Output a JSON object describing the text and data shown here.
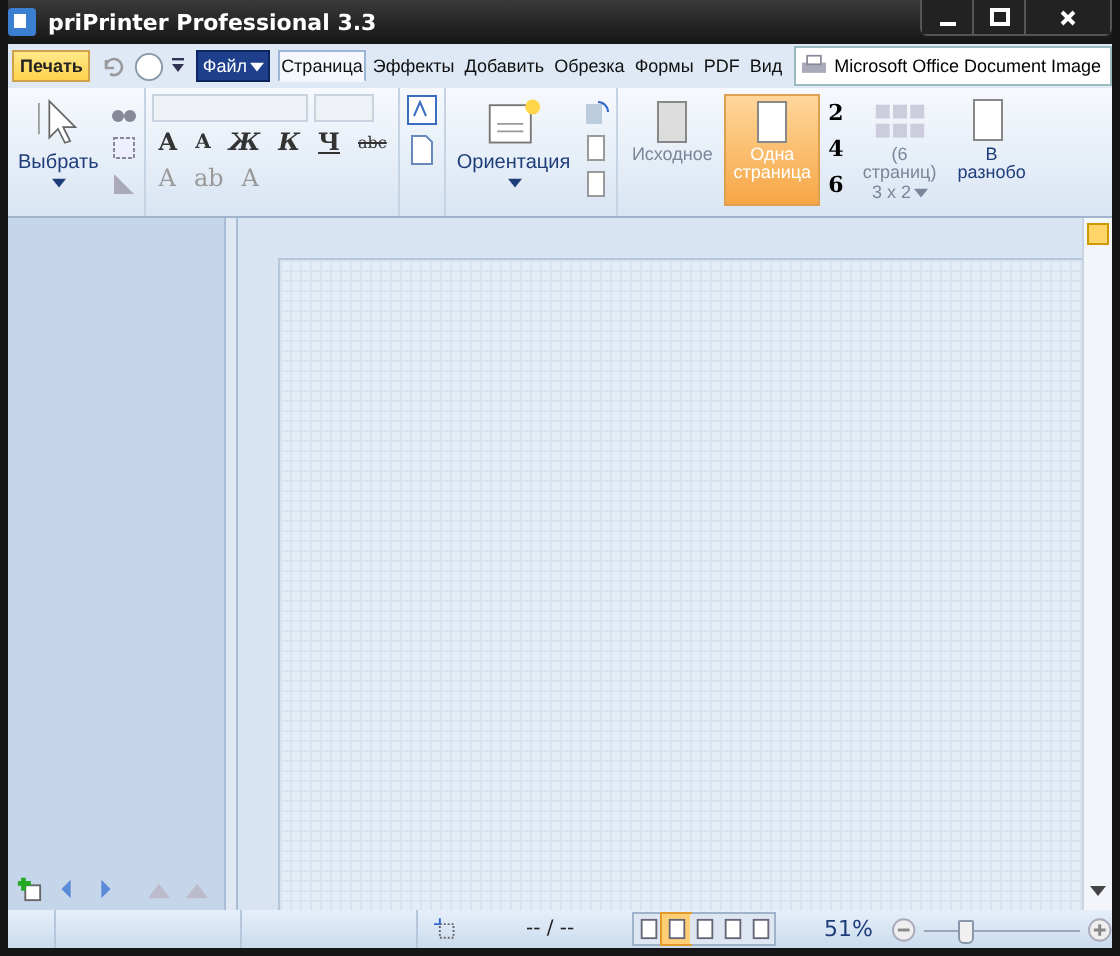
{
  "window": {
    "title": "priPrinter Professional 3.3"
  },
  "quick_access": {
    "print": "Печать",
    "file_menu": "Файл"
  },
  "tabs": [
    {
      "label": "Страница",
      "selected": true
    },
    {
      "label": "Эффекты",
      "selected": false
    },
    {
      "label": "Добавить",
      "selected": false
    },
    {
      "label": "Обрезка",
      "selected": false
    },
    {
      "label": "Формы",
      "selected": false
    },
    {
      "label": "PDF",
      "selected": false
    },
    {
      "label": "Вид",
      "selected": false
    }
  ],
  "printer": "Microsoft Office Document Image",
  "ribbon": {
    "select": "Выбрать",
    "font_buttons": [
      "A",
      "A",
      "Ж",
      "К",
      "Ч",
      "abc"
    ],
    "format_buttons": [
      "A",
      "ab",
      "A"
    ],
    "orientation": "Ориентация",
    "modes": [
      {
        "label": "Исходное",
        "disabled": true,
        "selected": false
      },
      {
        "label": "Одна страница",
        "disabled": false,
        "selected": true
      }
    ],
    "counts": [
      "2",
      "4",
      "6"
    ],
    "grid": {
      "label": "(6 страниц)",
      "size": "3 x 2"
    },
    "mixed": "В разнобо"
  },
  "status_bar": {
    "page": "-- / --",
    "zoom": "51%",
    "level": 0.25,
    "views": [
      {
        "selected": false
      },
      {
        "selected": true
      },
      {
        "selected": false
      },
      {
        "selected": false
      },
      {
        "selected": false
      }
    ]
  }
}
